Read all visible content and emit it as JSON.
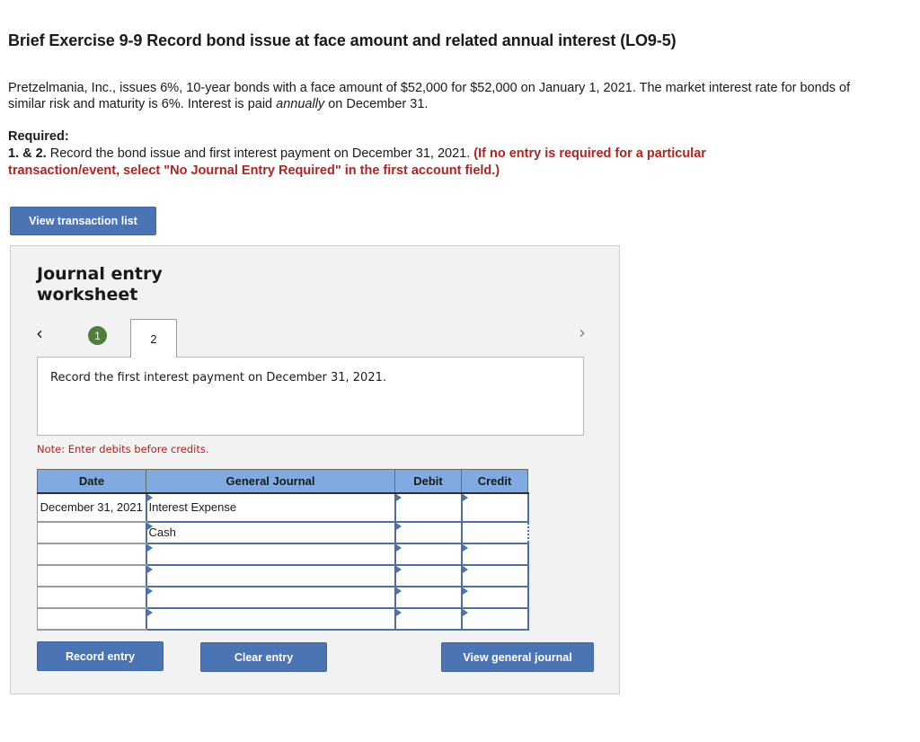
{
  "header": {
    "title": "Brief Exercise 9-9 Record bond issue at face amount and related annual interest (LO9-5)"
  },
  "problem": {
    "text_before_italic": "Pretzelmania, Inc., issues 6%, 10-year bonds with a face amount of $52,000 for $52,000 on January 1, 2021. The market interest rate for bonds of similar risk and maturity is 6%. Interest is paid ",
    "italic": "annually",
    "text_after_italic": " on December 31."
  },
  "required": {
    "label": "Required:",
    "number": "1. & 2.",
    "text": " Record the bond issue and first interest payment on December 31, 2021. ",
    "instruction": "(If no entry is required for a particular transaction/event, select \"No Journal Entry Required\" in the first account field.)"
  },
  "buttons": {
    "view_transaction_list": "View transaction list",
    "record_entry": "Record entry",
    "clear_entry": "Clear entry",
    "view_general_journal": "View general journal"
  },
  "worksheet": {
    "title": "Journal entry worksheet",
    "nav_prev": "‹",
    "nav_next": "›",
    "steps": [
      {
        "label": "1",
        "status": "completed",
        "color": "#4f7d3c"
      },
      {
        "label": "2",
        "status": "current"
      }
    ],
    "instruction": "Record the first interest payment on December 31, 2021.",
    "note": "Note: Enter debits before credits."
  },
  "journal": {
    "headers": [
      "Date",
      "General Journal",
      "Debit",
      "Credit"
    ],
    "rows": [
      {
        "date": "December 31, 2021",
        "account": "Interest Expense",
        "debit": "",
        "credit": ""
      },
      {
        "date": "",
        "account": "Cash",
        "debit": "",
        "credit": ""
      },
      {
        "date": "",
        "account": "",
        "debit": "",
        "credit": ""
      },
      {
        "date": "",
        "account": "",
        "debit": "",
        "credit": ""
      },
      {
        "date": "",
        "account": "",
        "debit": "",
        "credit": ""
      },
      {
        "date": "",
        "account": "",
        "debit": "",
        "credit": ""
      }
    ]
  },
  "colors": {
    "accent_button": "#4a74b4",
    "table_header": "#80abe0",
    "alert_red": "#b2231f"
  }
}
